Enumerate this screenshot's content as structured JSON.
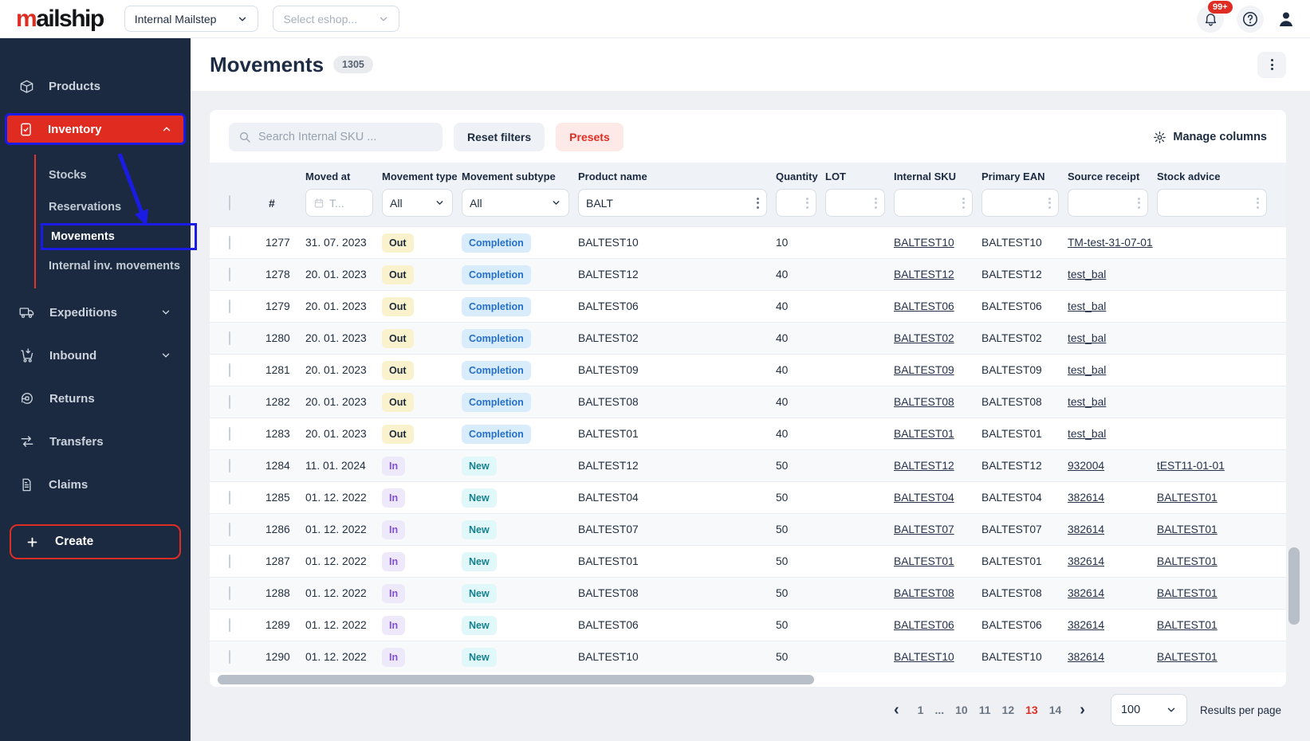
{
  "topbar": {
    "logo_prefix": "m",
    "logo_suffix": "ailship",
    "workspace_select_value": "Internal Mailstep",
    "eshop_select_placeholder": "Select eshop...",
    "notification_count": "99+"
  },
  "sidebar": {
    "items": [
      {
        "label": "Products"
      },
      {
        "label": "Inventory"
      },
      {
        "label": "Expeditions"
      },
      {
        "label": "Inbound"
      },
      {
        "label": "Returns"
      },
      {
        "label": "Transfers"
      },
      {
        "label": "Claims"
      }
    ],
    "inventory_submenu": [
      "Stocks",
      "Reservations",
      "Movements",
      "Internal inv. movements"
    ],
    "create_label": "Create"
  },
  "page": {
    "title": "Movements",
    "count_badge": "1305"
  },
  "toolbar": {
    "search_placeholder": "Search Internal SKU ...",
    "reset_filters_label": "Reset filters",
    "presets_label": "Presets",
    "manage_columns_label": "Manage columns"
  },
  "filters": {
    "hash_label": "#",
    "date_placeholder": "T...",
    "movement_type_value": "All",
    "movement_subtype_value": "All",
    "product_name_value": "BALT"
  },
  "table": {
    "columns": [
      "Moved at",
      "Movement type",
      "Movement subtype",
      "Product name",
      "Quantity",
      "LOT",
      "Internal SKU",
      "Primary EAN",
      "Source receipt",
      "Stock advice"
    ],
    "rows": [
      {
        "num": "1277",
        "moved_at": "31. 07. 2023",
        "type": "Out",
        "subtype": "Completion",
        "product": "BALTEST10",
        "qty": "10",
        "lot": "",
        "sku": "BALTEST10",
        "ean": "BALTEST10",
        "source": "TM-test-31-07-01",
        "advice": ""
      },
      {
        "num": "1278",
        "moved_at": "20. 01. 2023",
        "type": "Out",
        "subtype": "Completion",
        "product": "BALTEST12",
        "qty": "40",
        "lot": "",
        "sku": "BALTEST12",
        "ean": "BALTEST12",
        "source": "test_bal",
        "advice": ""
      },
      {
        "num": "1279",
        "moved_at": "20. 01. 2023",
        "type": "Out",
        "subtype": "Completion",
        "product": "BALTEST06",
        "qty": "40",
        "lot": "",
        "sku": "BALTEST06",
        "ean": "BALTEST06",
        "source": "test_bal",
        "advice": ""
      },
      {
        "num": "1280",
        "moved_at": "20. 01. 2023",
        "type": "Out",
        "subtype": "Completion",
        "product": "BALTEST02",
        "qty": "40",
        "lot": "",
        "sku": "BALTEST02",
        "ean": "BALTEST02",
        "source": "test_bal",
        "advice": ""
      },
      {
        "num": "1281",
        "moved_at": "20. 01. 2023",
        "type": "Out",
        "subtype": "Completion",
        "product": "BALTEST09",
        "qty": "40",
        "lot": "",
        "sku": "BALTEST09",
        "ean": "BALTEST09",
        "source": "test_bal",
        "advice": ""
      },
      {
        "num": "1282",
        "moved_at": "20. 01. 2023",
        "type": "Out",
        "subtype": "Completion",
        "product": "BALTEST08",
        "qty": "40",
        "lot": "",
        "sku": "BALTEST08",
        "ean": "BALTEST08",
        "source": "test_bal",
        "advice": ""
      },
      {
        "num": "1283",
        "moved_at": "20. 01. 2023",
        "type": "Out",
        "subtype": "Completion",
        "product": "BALTEST01",
        "qty": "40",
        "lot": "",
        "sku": "BALTEST01",
        "ean": "BALTEST01",
        "source": "test_bal",
        "advice": ""
      },
      {
        "num": "1284",
        "moved_at": "11. 01. 2024",
        "type": "In",
        "subtype": "New",
        "product": "BALTEST12",
        "qty": "50",
        "lot": "",
        "sku": "BALTEST12",
        "ean": "BALTEST12",
        "source": "932004",
        "advice": "tEST11-01-01"
      },
      {
        "num": "1285",
        "moved_at": "01. 12. 2022",
        "type": "In",
        "subtype": "New",
        "product": "BALTEST04",
        "qty": "50",
        "lot": "",
        "sku": "BALTEST04",
        "ean": "BALTEST04",
        "source": "382614",
        "advice": "BALTEST01"
      },
      {
        "num": "1286",
        "moved_at": "01. 12. 2022",
        "type": "In",
        "subtype": "New",
        "product": "BALTEST07",
        "qty": "50",
        "lot": "",
        "sku": "BALTEST07",
        "ean": "BALTEST07",
        "source": "382614",
        "advice": "BALTEST01"
      },
      {
        "num": "1287",
        "moved_at": "01. 12. 2022",
        "type": "In",
        "subtype": "New",
        "product": "BALTEST01",
        "qty": "50",
        "lot": "",
        "sku": "BALTEST01",
        "ean": "BALTEST01",
        "source": "382614",
        "advice": "BALTEST01"
      },
      {
        "num": "1288",
        "moved_at": "01. 12. 2022",
        "type": "In",
        "subtype": "New",
        "product": "BALTEST08",
        "qty": "50",
        "lot": "",
        "sku": "BALTEST08",
        "ean": "BALTEST08",
        "source": "382614",
        "advice": "BALTEST01"
      },
      {
        "num": "1289",
        "moved_at": "01. 12. 2022",
        "type": "In",
        "subtype": "New",
        "product": "BALTEST06",
        "qty": "50",
        "lot": "",
        "sku": "BALTEST06",
        "ean": "BALTEST06",
        "source": "382614",
        "advice": "BALTEST01"
      },
      {
        "num": "1290",
        "moved_at": "01. 12. 2022",
        "type": "In",
        "subtype": "New",
        "product": "BALTEST10",
        "qty": "50",
        "lot": "",
        "sku": "BALTEST10",
        "ean": "BALTEST10",
        "source": "382614",
        "advice": "BALTEST01"
      }
    ]
  },
  "pagination": {
    "pages": [
      "1",
      "...",
      "10",
      "11",
      "12",
      "13",
      "14"
    ],
    "current_page": "13",
    "per_page_value": "100",
    "per_page_label": "Results per page"
  },
  "icons": {
    "chevron_left": "‹",
    "chevron_right": "›"
  },
  "colors": {
    "brand_red": "#e02d23",
    "sidebar_navy": "#1b2a41",
    "annotation_blue": "#1b1be6",
    "badge_out_bg": "#faf2cc",
    "badge_completion_bg": "#d9ecfb",
    "badge_completion_text": "#2570c8",
    "badge_in_bg": "#eee9fa",
    "badge_in_text": "#8050d8",
    "badge_new_bg": "#e0f8fa",
    "badge_new_text": "#15818f"
  }
}
